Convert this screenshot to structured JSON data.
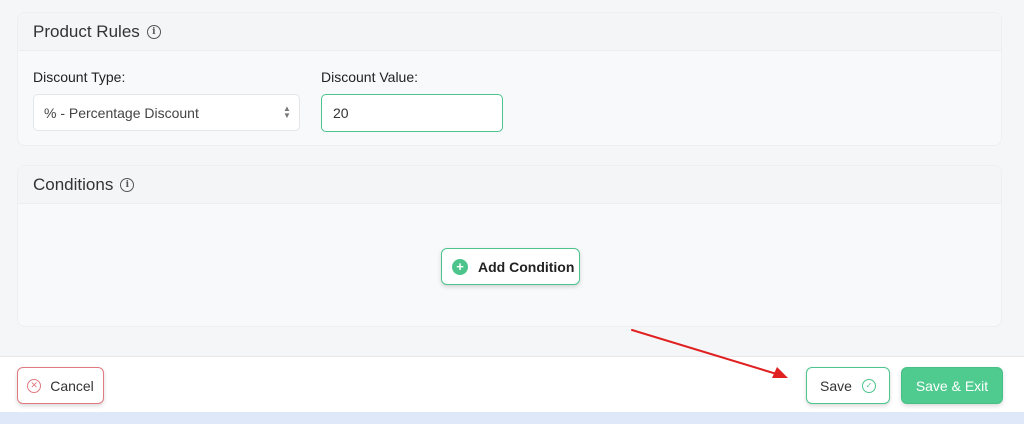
{
  "product_rules": {
    "title": "Product Rules",
    "discount_type": {
      "label": "Discount Type:",
      "selected": "% - Percentage Discount"
    },
    "discount_value": {
      "label": "Discount Value:",
      "value": "20"
    }
  },
  "conditions": {
    "title": "Conditions",
    "add_button_label": "Add Condition"
  },
  "footer": {
    "cancel_label": "Cancel",
    "save_label": "Save",
    "save_exit_label": "Save & Exit"
  },
  "icons": {
    "info": "info-icon",
    "plus": "plus-circle-icon",
    "cancel": "x-circle-icon",
    "check": "check-circle-icon",
    "select": "chevron-updown-icon"
  },
  "colors": {
    "accent_green": "#4cc48c",
    "cancel_red": "#e07a80",
    "annotation_arrow": "#e02020"
  }
}
